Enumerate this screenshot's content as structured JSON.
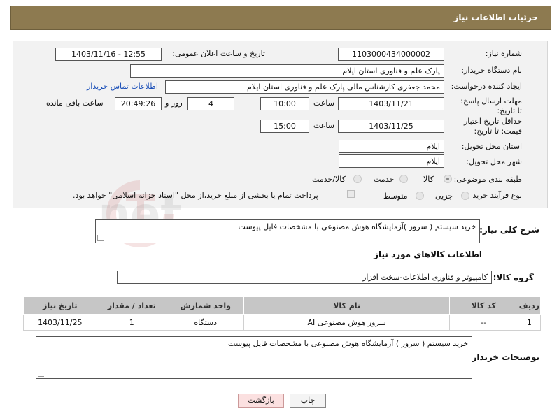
{
  "header": {
    "title": "جزئیات اطلاعات نیاز"
  },
  "form": {
    "need_number_label": "شماره نیاز:",
    "need_number_value": "1103000434000002",
    "announce_label": "تاریخ و ساعت اعلان عمومی:",
    "announce_value": "1403/11/16 - 12:55",
    "buyer_org_label": "نام دستگاه خریدار:",
    "buyer_org_value": "پارک علم و فناوری استان ایلام",
    "requester_label": "ایجاد کننده درخواست:",
    "requester_value": "محمد جعفری کارشناس مالی پارک علم و فناوری استان ایلام",
    "buyer_contact_link": "اطلاعات تماس خریدار",
    "deadline_label": "مهلت ارسال پاسخ: تا تاریخ:",
    "deadline_date": "1403/11/21",
    "time_label": "ساعت",
    "deadline_time": "10:00",
    "days_value": "4",
    "days_label": "روز و",
    "remaining_value": "20:49:26",
    "remaining_label": "ساعت باقی مانده",
    "validity_label": "حداقل تاریخ اعتبار قیمت: تا تاریخ:",
    "validity_date": "1403/11/25",
    "validity_time": "15:00",
    "province_label": "استان محل تحویل:",
    "province_value": "ایلام",
    "city_label": "شهر محل تحویل:",
    "city_value": "ایلام",
    "category_label": "طبقه بندی موضوعی:",
    "category_options": [
      "کالا",
      "خدمت",
      "کالا/خدمت"
    ],
    "category_selected": "کالا",
    "process_label": "نوع فرآیند خرید :",
    "process_options": [
      "جزیی",
      "متوسط"
    ],
    "payment_note": "پرداخت تمام یا بخشی از مبلغ خرید،از محل \"اسناد خزانه اسلامی\" خواهد بود."
  },
  "description": {
    "label": "شرح کلی نیاز:",
    "value": "خرید سیستم ( سرور )آزمایشگاه هوش مصنوعی با مشخصات فایل پیوست"
  },
  "goods": {
    "section_title": "اطلاعات کالاهای مورد نیاز",
    "group_label": "گروه کالا:",
    "group_value": "کامپیوتر و فناوری اطلاعات-سخت افزار",
    "table": {
      "headers": [
        "ردیف",
        "کد کالا",
        "نام کالا",
        "واحد شمارش",
        "تعداد / مقدار",
        "تاریخ نیاز"
      ],
      "rows": [
        [
          "1",
          "--",
          "سرور هوش مصنوعی AI",
          "دستگاه",
          "1",
          "1403/11/25"
        ]
      ]
    }
  },
  "buyer_notes": {
    "label": "توضیحات خریدار:",
    "value": "خرید سیستم ( سرور ) آزمایشگاه هوش مصنوعی با مشخصات فایل پیوست"
  },
  "buttons": {
    "print": "چاپ",
    "back": "بازگشت"
  },
  "watermark": {
    "text": "AriaTender.net"
  }
}
